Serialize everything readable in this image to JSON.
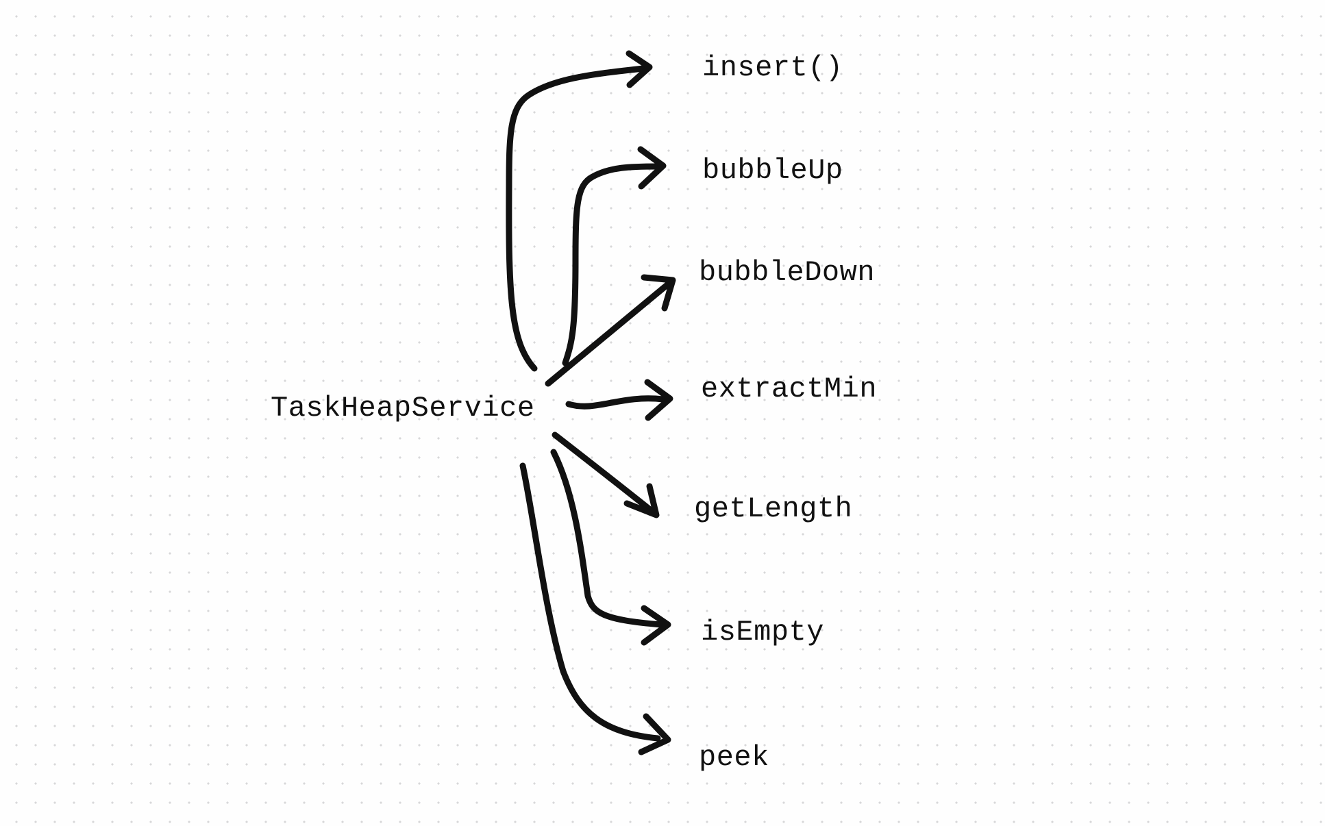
{
  "diagram": {
    "root": "TaskHeapService",
    "methods": [
      "insert()",
      "bubbleUp",
      "bubbleDown",
      "extractMin",
      "getLength",
      "isEmpty",
      "peek"
    ]
  }
}
